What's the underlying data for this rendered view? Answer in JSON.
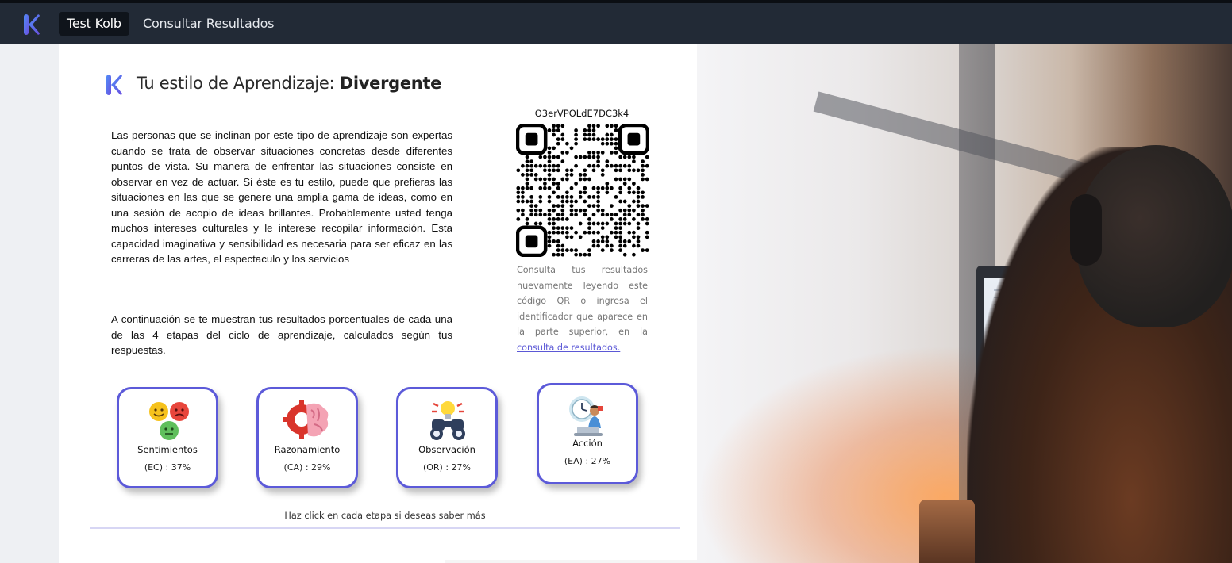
{
  "nav": {
    "logo_icon": "kolb-logo-icon",
    "tabs": [
      {
        "label": "Test Kolb",
        "active": true
      },
      {
        "label": "Consultar Resultados",
        "active": false
      }
    ]
  },
  "result": {
    "title_prefix": "Tu estilo de Aprendizaje: ",
    "title_style": "Divergente",
    "description": "Las personas que se inclinan por este tipo de aprendizaje son expertas cuando se trata de observar situaciones concretas desde diferentes puntos de vista. Su manera de enfrentar las situaciones consiste en observar en vez de actuar. Si éste es tu estilo, puede que prefieras las situaciones en las que se genere una amplia gama de ideas, como en una sesión de acopio de ideas brillantes. Probablemente usted tenga muchos intereses culturales y le interese recopilar información. Esta capacidad imaginativa y sensibilidad es necesaria para ser eficaz en las carreras de las artes, el espectaculo y los servicios",
    "percent_intro": "A continuación se te muestran tus resultados porcentuales de cada una de las 4 etapas del ciclo de aprendizaje, calculados según tus respuestas."
  },
  "qr": {
    "id": "O3erVPOLdE7DC3k4",
    "text": "Consulta tus resultados nuevamente leyendo este código QR o ingresa el identificador que aparece en la parte superior, en la ",
    "link_text": "consulta de resultados."
  },
  "stages": [
    {
      "name": "Sentimientos",
      "value": "(EC) : 37%",
      "icon": "emoji-faces-icon"
    },
    {
      "name": "Razonamiento",
      "value": "(CA) : 29%",
      "icon": "brain-gear-icon"
    },
    {
      "name": "Observación",
      "value": "(OR) : 27%",
      "icon": "binoculars-lightbulb-icon"
    },
    {
      "name": "Acción",
      "value": "(EA) : 27%",
      "icon": "person-laptop-clock-icon"
    }
  ],
  "hint": "Haz click en cada etapa si deseas saber más",
  "colors": {
    "nav_bg": "#222a36",
    "accent": "#5c5ad9",
    "logo": "#5b5fe0"
  }
}
